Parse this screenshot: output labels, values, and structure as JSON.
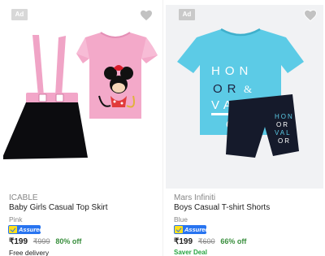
{
  "products": [
    {
      "ad": "Ad",
      "brand": "ICABLE",
      "name": "Baby Girls Casual Top Skirt",
      "color": "Pink",
      "assured": "Assured",
      "price": "₹199",
      "mrp": "₹999",
      "discount": "80% off",
      "note": "Free delivery",
      "icons": {
        "wishlist": "heart-icon",
        "assured": "flipkart-assured-icon"
      }
    },
    {
      "ad": "Ad",
      "brand": "Mars Infiniti",
      "name": "Boys Casual T-shirt Shorts",
      "color": "Blue",
      "assured": "Assured",
      "price": "₹199",
      "mrp": "₹600",
      "discount": "66% off",
      "note": "Saver Deal",
      "tshirt_print": [
        "HON",
        "OR",
        "&",
        "VAL",
        "OR"
      ],
      "shorts_print": [
        "HON",
        "OR",
        "VAL",
        "OR"
      ],
      "icons": {
        "wishlist": "heart-icon",
        "assured": "flipkart-assured-icon"
      }
    }
  ],
  "colors": {
    "assured_blue": "#2874f0",
    "discount_green": "#388e3c",
    "tshirt_cyan": "#5ccbe6",
    "top_pink": "#f2a6c8",
    "navy": "#151a2b"
  }
}
